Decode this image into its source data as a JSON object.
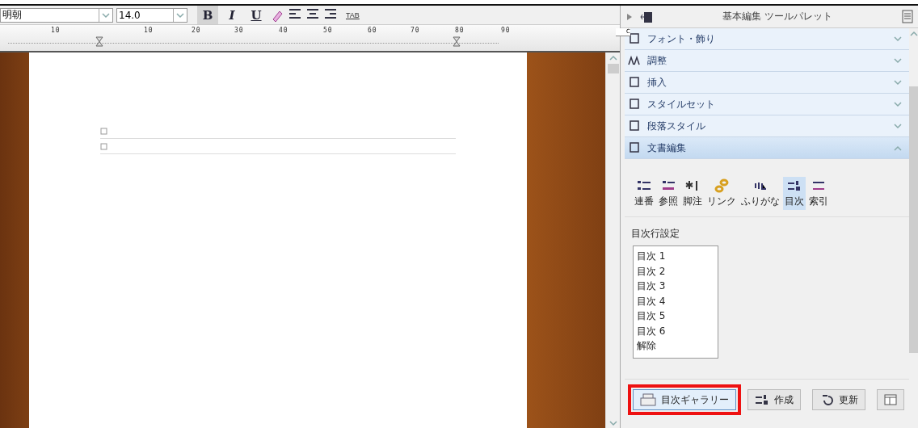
{
  "toolbar": {
    "font": "明朝",
    "size": "14.0",
    "format_buttons": [
      {
        "kind": "bold",
        "label": "B",
        "selected": true
      },
      {
        "kind": "italic",
        "label": "I",
        "selected": false
      },
      {
        "kind": "underline",
        "label": "U",
        "selected": false
      }
    ],
    "tab_label": "TAB"
  },
  "ruler": {
    "labels": [
      "10",
      "10",
      "20",
      "30",
      "40",
      "50",
      "60",
      "70",
      "80",
      "90"
    ],
    "corner": "C"
  },
  "palette": {
    "title": "基本編集 ツールパレット",
    "sections": [
      {
        "label": "フォント・飾り",
        "expanded": false
      },
      {
        "label": "調整",
        "expanded": false
      },
      {
        "label": "挿入",
        "expanded": false
      },
      {
        "label": "スタイルセット",
        "expanded": false
      },
      {
        "label": "段落スタイル",
        "expanded": false
      },
      {
        "label": "文書編集",
        "expanded": true
      }
    ],
    "tools": [
      {
        "kind": "numbering",
        "label": "連番",
        "selected": false
      },
      {
        "kind": "reference",
        "label": "参照",
        "selected": false
      },
      {
        "kind": "footnote",
        "label": "脚注",
        "selected": false
      },
      {
        "kind": "link",
        "label": "リンク",
        "selected": false
      },
      {
        "kind": "ruby",
        "label": "ふりがな",
        "selected": false
      },
      {
        "kind": "toc",
        "label": "目次",
        "selected": true
      },
      {
        "kind": "index",
        "label": "索引",
        "selected": false
      }
    ],
    "toc_label": "目次行設定",
    "toc_items": [
      "目次 1",
      "目次 2",
      "目次 3",
      "目次 4",
      "目次 5",
      "目次 6",
      "解除"
    ],
    "buttons": [
      {
        "kind": "gallery",
        "label": "目次ギャラリー",
        "highlighted": true
      },
      {
        "kind": "create",
        "label": "作成",
        "highlighted": false
      },
      {
        "kind": "update",
        "label": "更新",
        "highlighted": false
      },
      {
        "kind": "layout",
        "highlighted": false
      }
    ]
  }
}
